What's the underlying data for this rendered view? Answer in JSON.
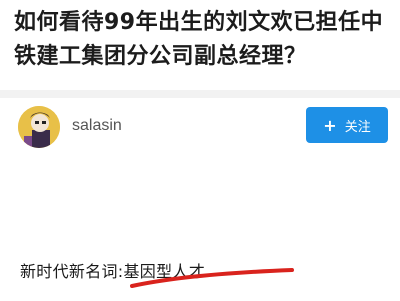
{
  "question": {
    "title": "如何看待99年出生的刘文欢已担任中铁建工集团分公司副总经理？"
  },
  "author": {
    "name": "salasin",
    "avatar_icon": "avatar-image"
  },
  "follow_button": {
    "icon": "plus-icon",
    "icon_glyph": "+",
    "label": "关注",
    "color": "#1e90e6"
  },
  "answer": {
    "text": "新时代新名词:基因型人才"
  },
  "annotation": {
    "underline_color": "#d9231d"
  }
}
